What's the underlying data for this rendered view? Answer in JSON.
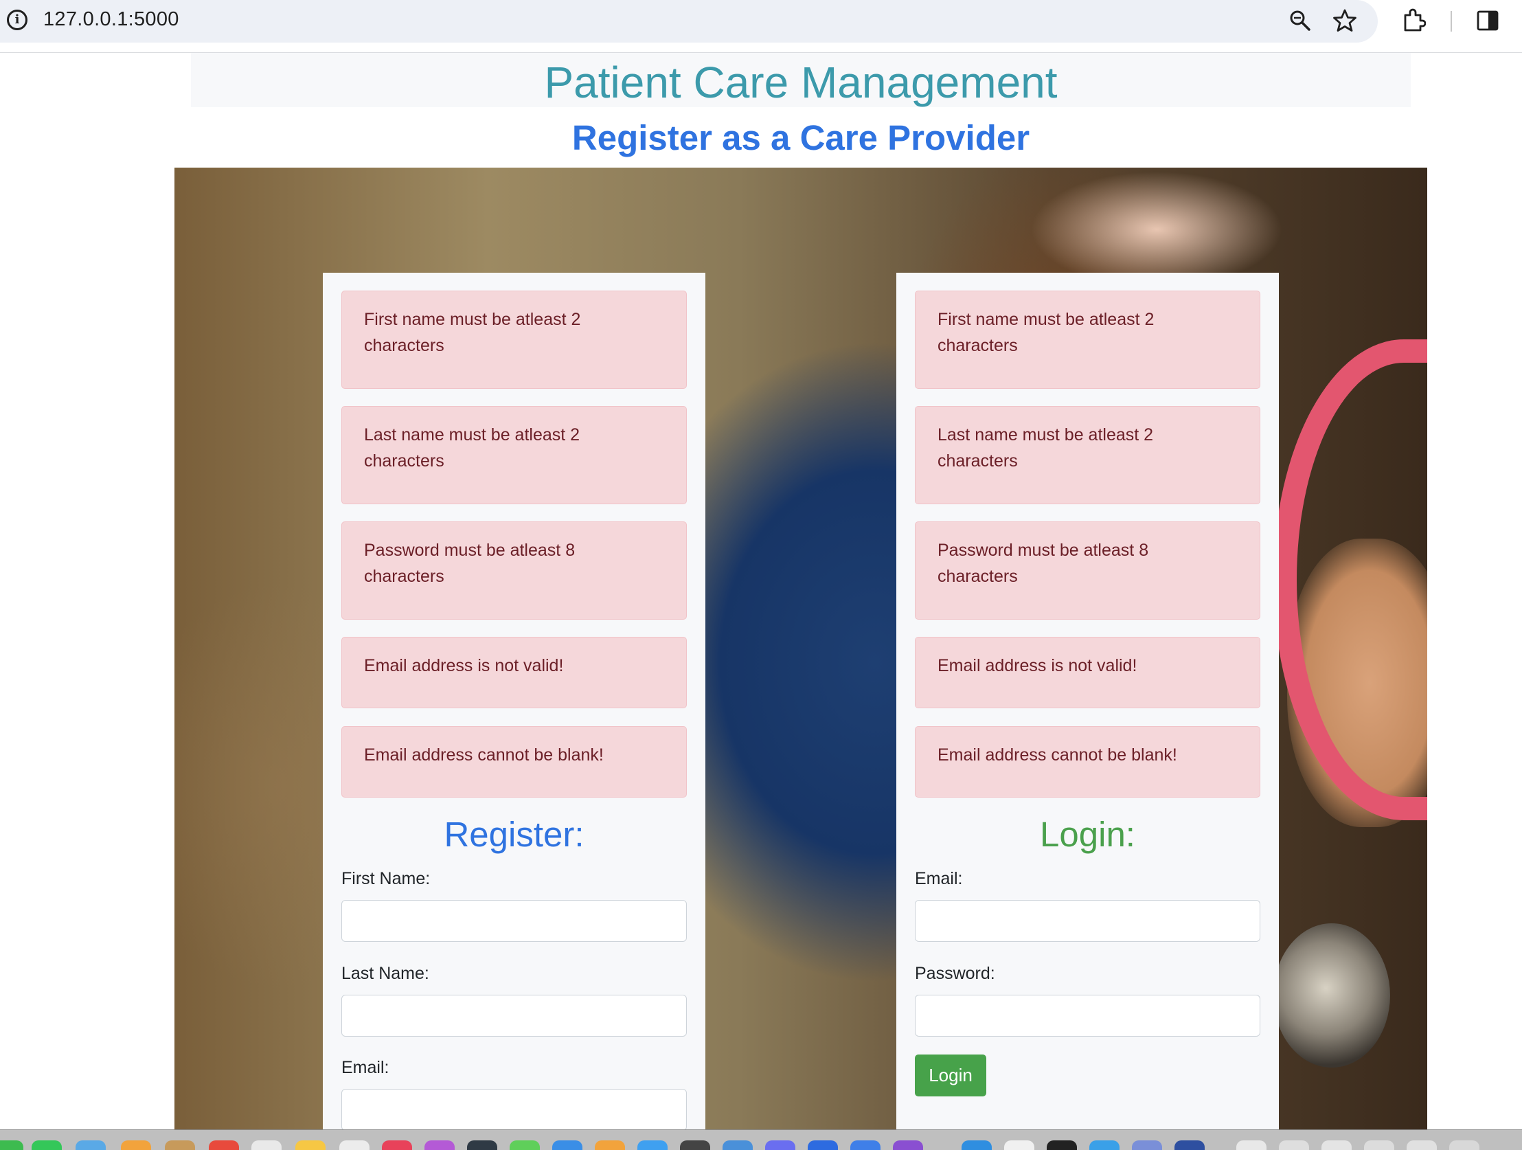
{
  "browser": {
    "url": "127.0.0.1:5000",
    "icons": [
      "info-icon",
      "zoom-icon",
      "bookmark-star-icon",
      "extensions-icon",
      "side-panel-icon"
    ]
  },
  "header": {
    "title": "Patient Care Management",
    "subtitle": "Register as a Care Provider"
  },
  "register": {
    "errors": [
      "First name must be atleast 2 characters",
      "Last name must be atleast 2 characters",
      "Password must be atleast 8 characters",
      "Email address is not valid!",
      "Email address cannot be blank!"
    ],
    "title": "Register:",
    "first_name_label": "First Name:",
    "first_name_value": "",
    "last_name_label": "Last Name:",
    "last_name_value": "",
    "email_label": "Email:",
    "email_value": ""
  },
  "login": {
    "errors": [
      "First name must be atleast 2 characters",
      "Last name must be atleast 2 characters",
      "Password must be atleast 8 characters",
      "Email address is not valid!",
      "Email address cannot be blank!"
    ],
    "title": "Login:",
    "email_label": "Email:",
    "email_value": "",
    "password_label": "Password:",
    "password_value": "",
    "button_label": "Login"
  },
  "colors": {
    "title": "#3c9aab",
    "subtitle": "#2f73e0",
    "register_title": "#2f73e0",
    "login_title": "#4aa04c",
    "alert_bg": "#f5d7da",
    "alert_text": "#6b1f27",
    "login_button": "#47a24a"
  }
}
